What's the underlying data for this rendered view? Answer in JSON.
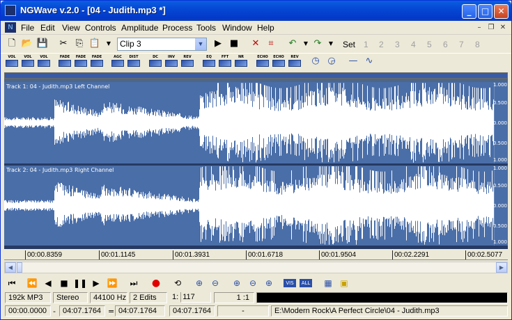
{
  "window": {
    "title": "NGWave v.2.0 - [04 - Judith.mp3 *]"
  },
  "caption_buttons": [
    "minimize-icon",
    "maximize-icon",
    "close-icon"
  ],
  "menu": [
    "File",
    "Edit",
    "View",
    "Controls",
    "Amplitude",
    "Process",
    "Tools",
    "Window",
    "Help"
  ],
  "toolbar": {
    "clip_select": "Clip 3",
    "set_label": "Set",
    "set_numbers": [
      "1",
      "2",
      "3",
      "4",
      "5",
      "6",
      "7",
      "8"
    ]
  },
  "effects": [
    "VOL",
    "VOL",
    "VOL",
    "FADE",
    "FADE",
    "FADE",
    "AGC",
    "DIST",
    "DC",
    "INV",
    "REV",
    "EQ",
    "FFT",
    "NR",
    "ECHO",
    "ECHO",
    "REV"
  ],
  "tracks": [
    {
      "label": "Track 1: 04 - Judith.mp3 Left Channel",
      "scale": [
        "1.000",
        "0.500",
        "0.000",
        "0.500",
        "1.000"
      ]
    },
    {
      "label": "Track 2: 04 - Judith.mp3 Right Channel",
      "scale": [
        "1.000",
        "0.500",
        "0.000",
        "0.500",
        "1.000"
      ]
    }
  ],
  "ruler": [
    "00:00.8359",
    "00:01.1145",
    "00:01.3931",
    "00:01.6718",
    "00:01.9504",
    "00:02.2291",
    "00:02.5077"
  ],
  "status": {
    "bitrate": "192k MP3",
    "channels": "Stereo",
    "rate": "44100 Hz",
    "edits": "2 Edits",
    "zoom_label": "1:",
    "zoom_value": "117",
    "ratio": "1 :1",
    "sel_start": "00:00.0000",
    "sep1": "-",
    "sel_end": "04:07.1764",
    "sep2": "=",
    "sel_len": "04:07.1764",
    "total": "04:07.1764",
    "cursor": "-",
    "path": "E:\\Modern Rock\\A Perfect Circle\\04 - Judith.mp3"
  },
  "colors": {
    "track_bg": "#4a6ea8",
    "waveform": "#ffffff",
    "titlebar": "#0548d4"
  }
}
